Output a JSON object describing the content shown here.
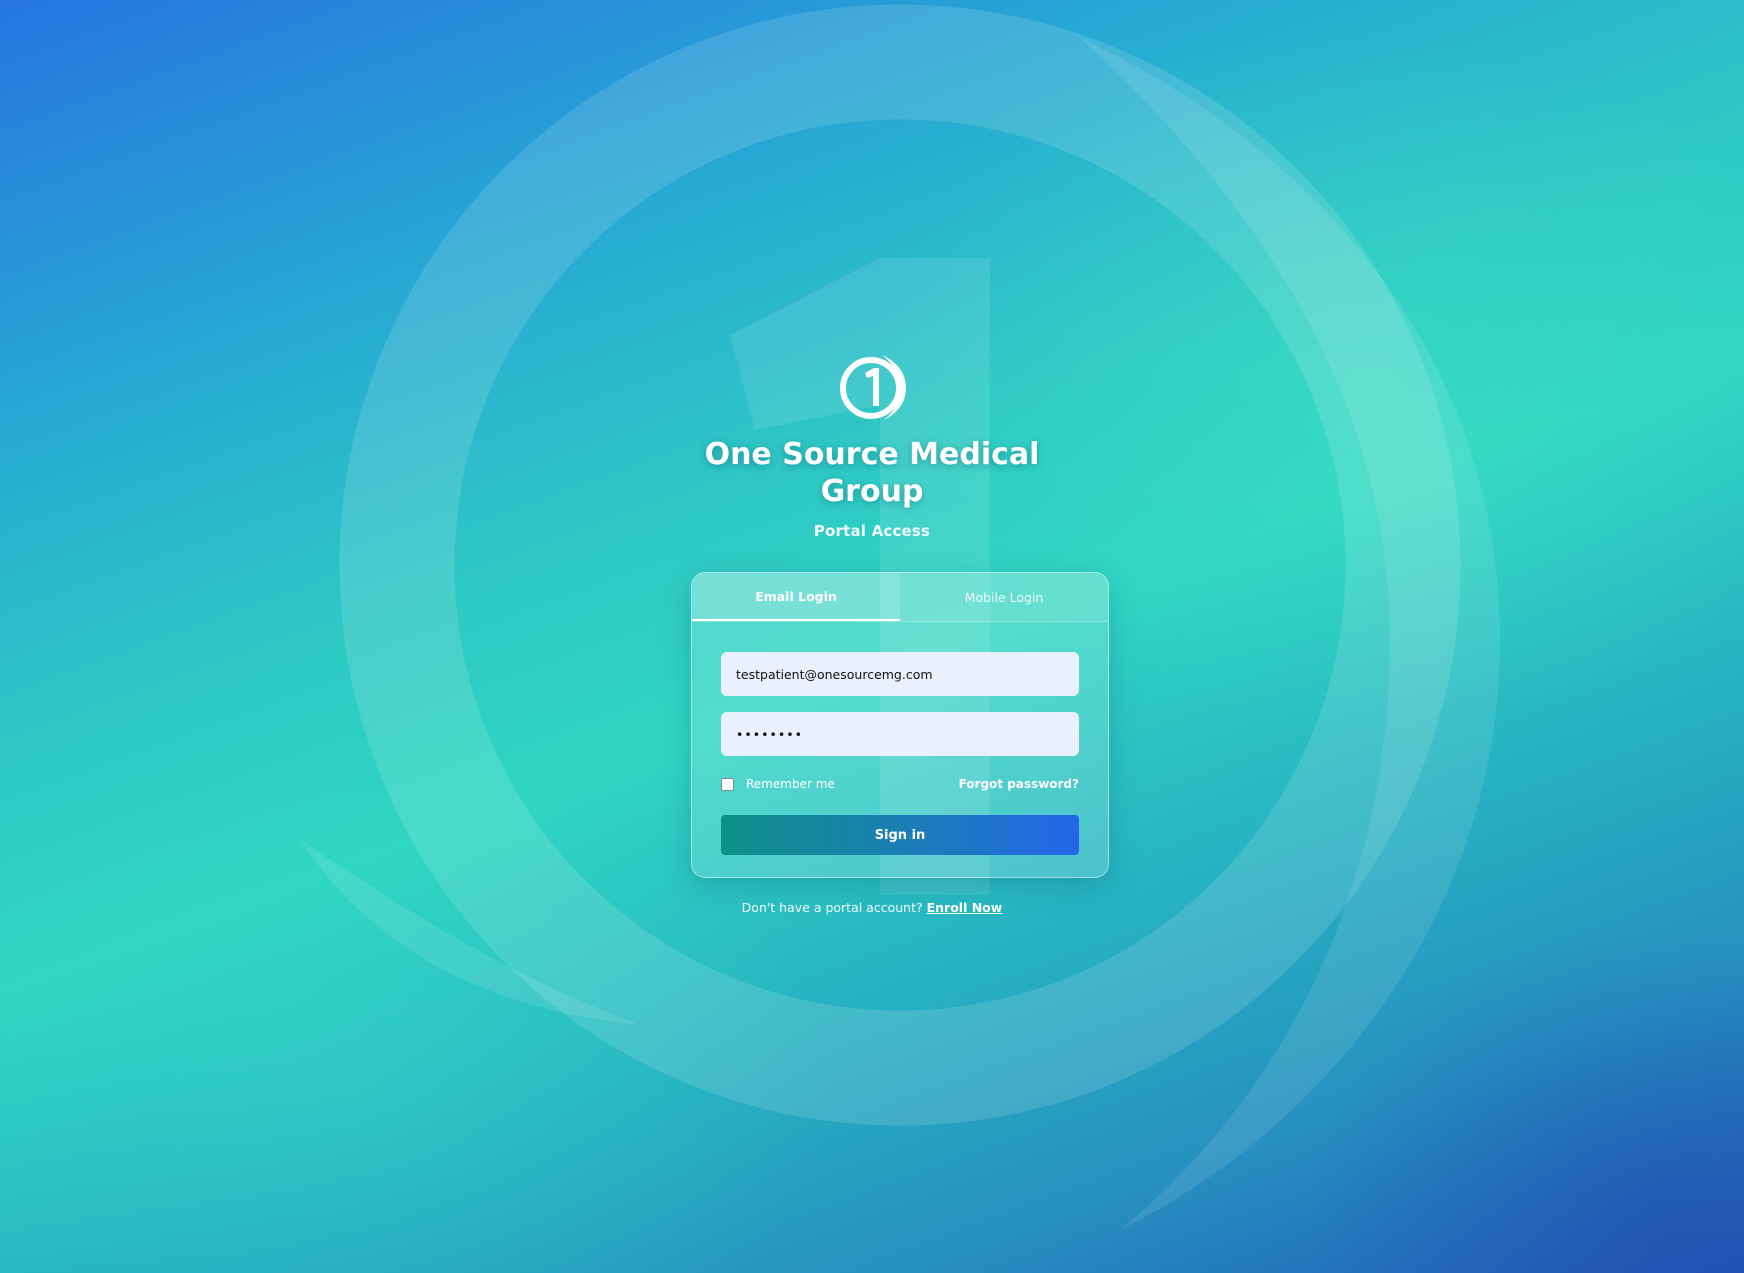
{
  "brand": {
    "title": "One Source Medical Group",
    "subtitle": "Portal Access",
    "logo_icon": "one-circle-logo-icon"
  },
  "tabs": [
    {
      "label": "Email Login",
      "active": true
    },
    {
      "label": "Mobile Login",
      "active": false
    }
  ],
  "form": {
    "email_value": "testpatient@onesourcemg.com",
    "password_value": "••••••••",
    "remember_label": "Remember me",
    "remember_checked": false,
    "forgot_label": "Forgot password?",
    "signin_label": "Sign in"
  },
  "footer": {
    "prompt": "Don't have a portal account?",
    "enroll_label": "Enroll Now"
  },
  "colors": {
    "button_gradient_start": "#0e9188",
    "button_gradient_end": "#2566e8",
    "input_background": "#eaf1fc"
  }
}
